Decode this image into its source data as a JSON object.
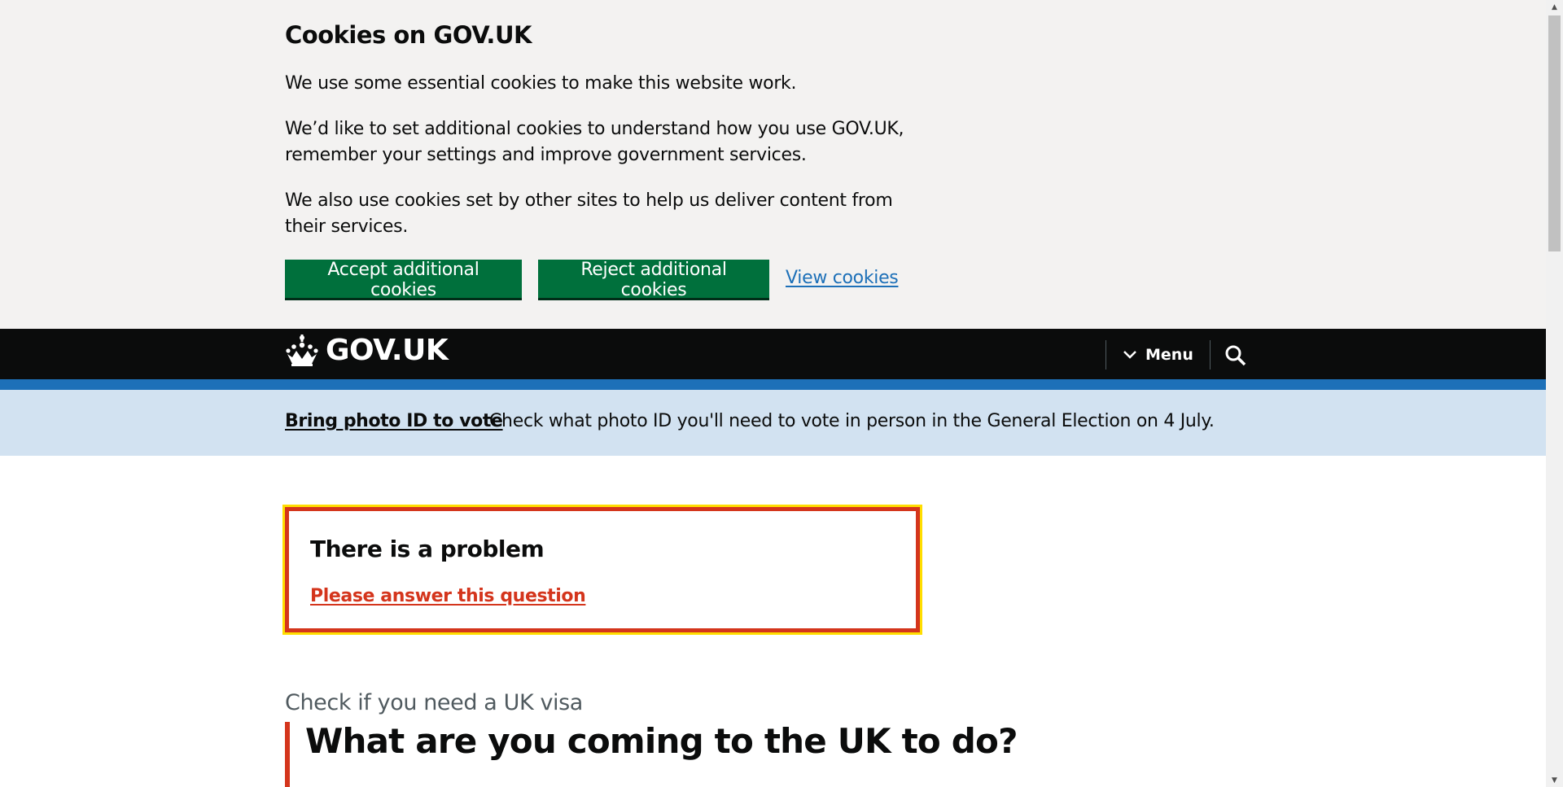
{
  "cookie_banner": {
    "title": "Cookies on GOV.UK",
    "p1": "We use some essential cookies to make this website work.",
    "p2": "We’d like to set additional cookies to understand how you use GOV.UK, remember your settings and improve government services.",
    "p3": "We also use cookies set by other sites to help us deliver content from their services.",
    "accept_label": "Accept additional cookies",
    "reject_label": "Reject additional cookies",
    "view_label": "View cookies"
  },
  "header": {
    "logo_text": "GOV.UK",
    "menu_label": "Menu",
    "colors": {
      "header_bg": "#0b0c0c",
      "rule": "#1d70b8"
    }
  },
  "global_banner": {
    "link_text": "Bring photo ID to vote",
    "text": "Check what photo ID you'll need to vote in person in the General Election on 4 July."
  },
  "error_summary": {
    "title": "There is a problem",
    "link_text": "Please answer this question",
    "colors": {
      "border": "#d4351c",
      "focus": "#ffdd00"
    }
  },
  "question": {
    "caption": "Check if you need a UK visa",
    "heading": "What are you coming to the UK to do?"
  },
  "icons": {
    "crown": "crown-icon",
    "menu_chevron": "chevron-down-icon",
    "search": "search-icon"
  }
}
